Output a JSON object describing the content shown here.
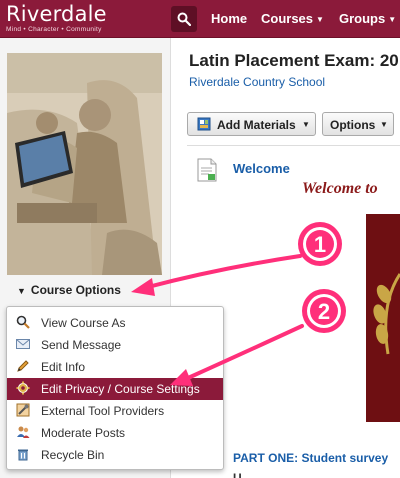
{
  "header": {
    "brand_name": "Riverdale",
    "brand_tagline": "Mind • Character • Community",
    "nav": [
      {
        "label": "Home"
      },
      {
        "label": "Courses"
      },
      {
        "label": "Groups"
      }
    ],
    "icons": {
      "search": "search-icon"
    },
    "colors": {
      "brand": "#8b1a3a",
      "link": "#1a5ea8",
      "annotation": "#ff2f7a"
    }
  },
  "left": {
    "course_options_label": "Course Options",
    "menu_items": [
      {
        "label": "View Course As",
        "icon": "magnifier-icon"
      },
      {
        "label": "Send Message",
        "icon": "envelope-icon"
      },
      {
        "label": "Edit Info",
        "icon": "pencil-icon"
      },
      {
        "label": "Edit Privacy / Course Settings",
        "icon": "gear-icon",
        "active": true
      },
      {
        "label": "External Tool Providers",
        "icon": "tools-icon"
      },
      {
        "label": "Moderate Posts",
        "icon": "people-icon"
      },
      {
        "label": "Recycle Bin",
        "icon": "recycle-bin-icon"
      }
    ]
  },
  "main": {
    "course_title": "Latin Placement Exam: 20",
    "school": "Riverdale Country School",
    "add_materials_label": "Add Materials",
    "options_label": "Options",
    "welcome_link": "Welcome",
    "welcome_heading": "Welcome to",
    "part_one_link": "PART ONE: Student survey",
    "cutoff_text": "U"
  },
  "annotations": {
    "callout_1": "1",
    "callout_2": "2"
  }
}
